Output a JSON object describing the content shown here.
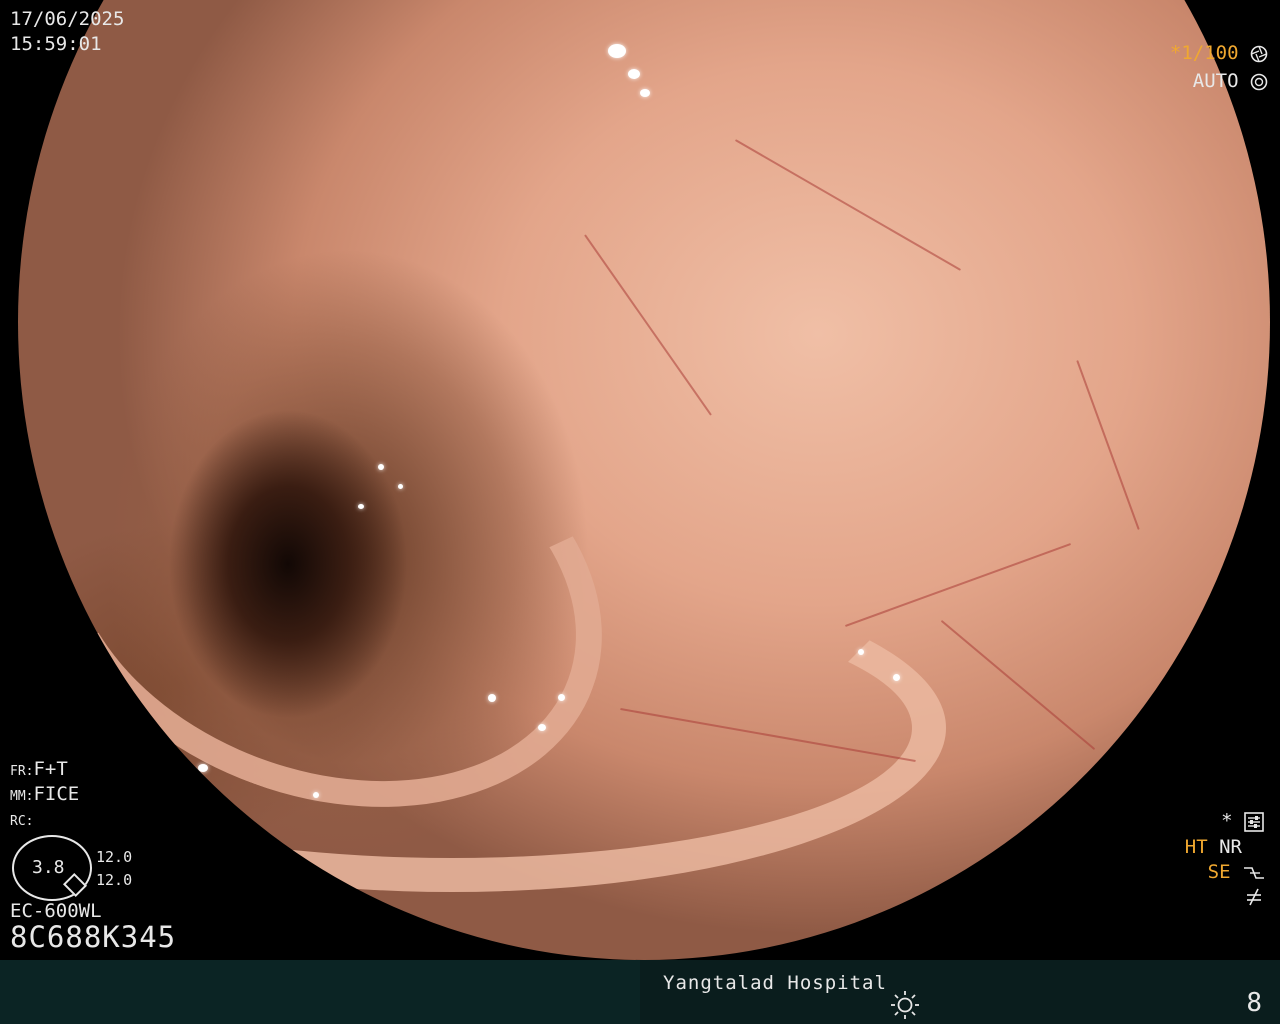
{
  "overlay": {
    "date": "17/06/2025",
    "time": "15:59:01",
    "shutter": "*1/100",
    "iris_mode": "AUTO",
    "fr_label": "FR:",
    "fr_value": "F+T",
    "mm_label": "MM:",
    "mm_value": "FICE",
    "rc_label": "RC:",
    "gauge_value": "3.8",
    "gauge_top": "12.0",
    "gauge_bottom": "12.0",
    "scope_model": "EC-600WL",
    "serial": "8C688K345",
    "asterisk": "*",
    "ht_label": "HT",
    "nr_label": "NR",
    "se_label": "SE"
  },
  "footer": {
    "hospital": "Yangtalad Hospital",
    "page": "8"
  },
  "colors": {
    "overlay_text": "#e8e8e8",
    "highlight": "#f0a830",
    "bar_left": "#0b2424",
    "bar_right": "#0a1d1d"
  },
  "icons": [
    "aperture-icon",
    "iris-icon",
    "settings-sliders-icon",
    "enhancement-icon",
    "freeze-icon",
    "brightness-sun-icon"
  ]
}
